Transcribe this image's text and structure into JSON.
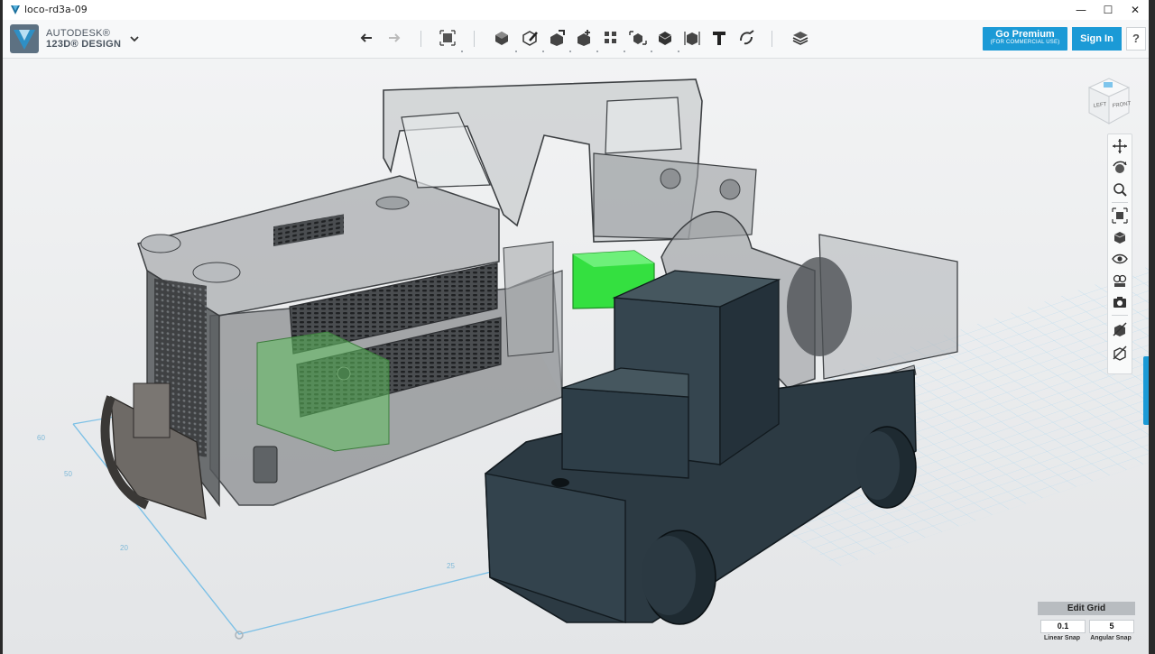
{
  "window": {
    "title": "loco-rd3a-09",
    "controls": {
      "minimize": "—",
      "maximize": "☐",
      "close": "✕"
    }
  },
  "brand": {
    "line1": "AUTODESK®",
    "line2": "123D® DESIGN",
    "accent": "#1b9ad6"
  },
  "toolbar": {
    "tools": [
      "undo-icon",
      "redo-icon",
      "transform-icon",
      "primitives-icon",
      "sketch-icon",
      "construct-icon",
      "modify-icon",
      "pattern-icon",
      "grouping-icon",
      "combine-icon",
      "measure-icon",
      "text-icon",
      "snap-icon",
      "material-icon"
    ]
  },
  "account": {
    "premium_label": "Go Premium",
    "premium_sub": "(FOR COMMERCIAL USE)",
    "signin_label": "Sign In",
    "help_label": "?"
  },
  "viewcube": {
    "left_label": "LEFT",
    "front_label": "FRONT"
  },
  "grid_labels": {
    "a": "60",
    "b": "50",
    "c": "20",
    "d": "25"
  },
  "grid_panel": {
    "edit_label": "Edit Grid",
    "linear_value": "0.1",
    "angular_value": "5",
    "linear_label": "Linear Snap",
    "angular_label": "Angular Snap"
  }
}
